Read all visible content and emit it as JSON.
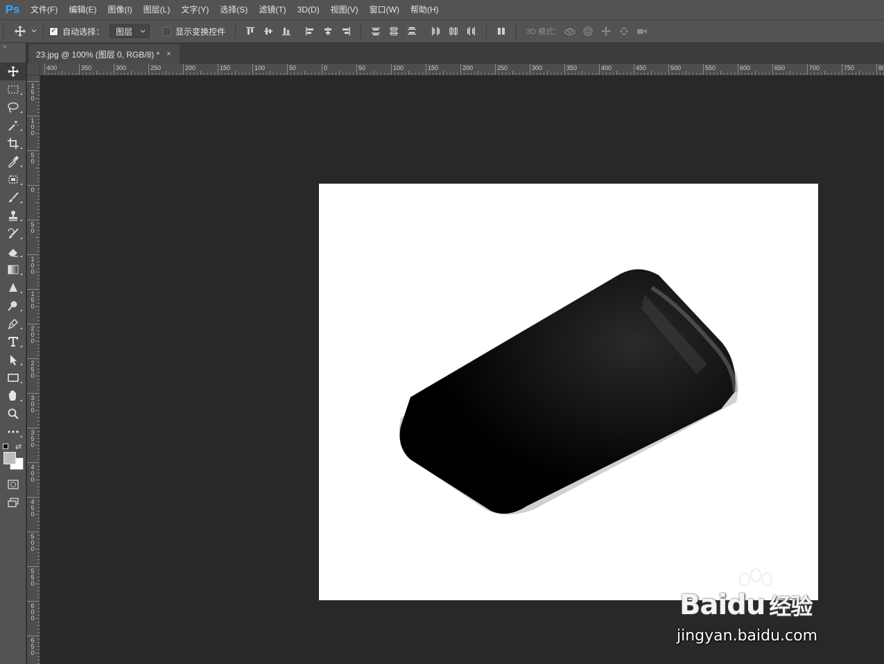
{
  "app": {
    "logo": "Ps",
    "accent": "#31a8ff"
  },
  "menu": [
    "文件(F)",
    "编辑(E)",
    "图像(I)",
    "图层(L)",
    "文字(Y)",
    "选择(S)",
    "滤镜(T)",
    "3D(D)",
    "视图(V)",
    "窗口(W)",
    "帮助(H)"
  ],
  "options": {
    "auto_select_label": "自动选择：",
    "auto_select_checked": true,
    "layer_select_value": "图层",
    "show_transform_label": "显示变换控件",
    "show_transform_checked": false,
    "mode_3d_label": "3D 模式："
  },
  "toolbar": {
    "tools": [
      "move-tool",
      "marquee-tool",
      "lasso-tool",
      "magic-wand-tool",
      "crop-tool",
      "eyedropper-tool",
      "healing-brush-tool",
      "brush-tool",
      "clone-stamp-tool",
      "history-brush-tool",
      "eraser-tool",
      "gradient-tool",
      "blur-tool",
      "dodge-tool",
      "pen-tool",
      "type-tool",
      "path-selection-tool",
      "rectangle-tool",
      "hand-tool",
      "zoom-tool",
      "more-tools"
    ],
    "foreground_color": "#bdbdbd",
    "background_color": "#ffffff"
  },
  "document_tab": {
    "title": "23.jpg @ 100% (图层 0, RGB/8) *",
    "close": "×"
  },
  "ruler": {
    "horizontal": [
      "400",
      "350",
      "300",
      "250",
      "200",
      "150",
      "100",
      "50",
      "0",
      "50",
      "100",
      "150",
      "200",
      "250",
      "300",
      "350",
      "400",
      "450",
      "500",
      "550",
      "600",
      "650",
      "700",
      "750",
      "80"
    ],
    "vertical": [
      "150",
      "100",
      "50",
      "0",
      "50",
      "100",
      "150",
      "200",
      "250",
      "300",
      "350",
      "400",
      "450",
      "500",
      "550",
      "600",
      "650"
    ]
  },
  "watermark": {
    "brand": "Bai",
    "brand2": "du",
    "brand_cn": "经验",
    "url": "jingyan.baidu.com"
  }
}
